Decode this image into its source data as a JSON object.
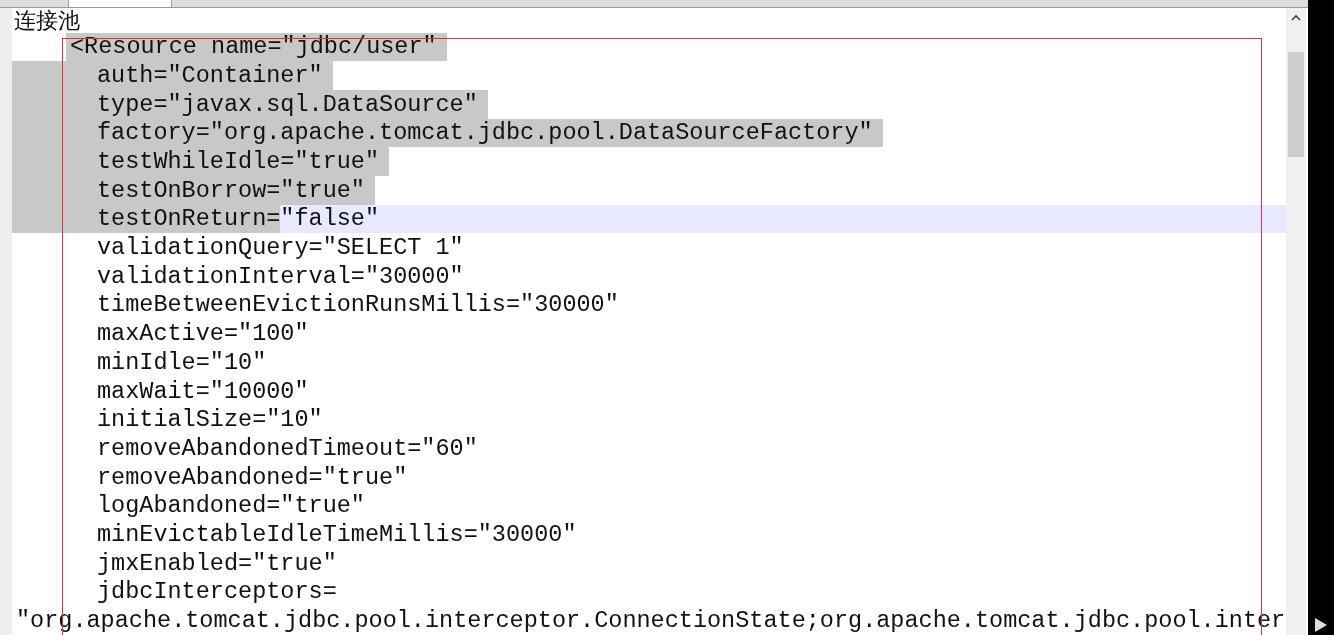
{
  "heading": "连接池",
  "lines": [
    {
      "kind": "tag",
      "text": "<Resource name=\"jdbc/user\"",
      "selected": true,
      "current": false
    },
    {
      "kind": "attribute",
      "text": "auth=\"Container\"",
      "selected": true,
      "current": false
    },
    {
      "kind": "attribute",
      "text": "type=\"javax.sql.DataSource\"",
      "selected": true,
      "current": false
    },
    {
      "kind": "attribute",
      "text": "factory=\"org.apache.tomcat.jdbc.pool.DataSourceFactory\"",
      "selected": true,
      "current": false
    },
    {
      "kind": "attribute",
      "text": "testWhileIdle=\"true\"",
      "selected": true,
      "current": false
    },
    {
      "kind": "attribute",
      "text": "testOnBorrow=\"true\"",
      "selected": true,
      "current": false
    },
    {
      "kind": "attribute",
      "selected_text": "testOnReturn=",
      "text": "\"false\"",
      "selected": true,
      "current": true
    },
    {
      "kind": "attribute",
      "text": "validationQuery=\"SELECT 1\"",
      "selected": false,
      "current": false
    },
    {
      "kind": "attribute",
      "text": "validationInterval=\"30000\"",
      "selected": false,
      "current": false
    },
    {
      "kind": "attribute",
      "text": "timeBetweenEvictionRunsMillis=\"30000\"",
      "selected": false,
      "current": false
    },
    {
      "kind": "attribute",
      "text": "maxActive=\"100\"",
      "selected": false,
      "current": false
    },
    {
      "kind": "attribute",
      "text": "minIdle=\"10\"",
      "selected": false,
      "current": false
    },
    {
      "kind": "attribute",
      "text": "maxWait=\"10000\"",
      "selected": false,
      "current": false
    },
    {
      "kind": "attribute",
      "text": "initialSize=\"10\"",
      "selected": false,
      "current": false
    },
    {
      "kind": "attribute",
      "text": "removeAbandonedTimeout=\"60\"",
      "selected": false,
      "current": false
    },
    {
      "kind": "attribute",
      "text": "removeAbandoned=\"true\"",
      "selected": false,
      "current": false
    },
    {
      "kind": "attribute",
      "text": "logAbandoned=\"true\"",
      "selected": false,
      "current": false
    },
    {
      "kind": "attribute",
      "text": "minEvictableIdleTimeMillis=\"30000\"",
      "selected": false,
      "current": false
    },
    {
      "kind": "attribute",
      "text": "jmxEnabled=\"true\"",
      "selected": false,
      "current": false
    },
    {
      "kind": "attribute",
      "text": "jdbcInterceptors=",
      "selected": false,
      "current": false
    },
    {
      "kind": "wrapped",
      "text": "\"org.apache.tomcat.jdbc.pool.interceptor.ConnectionState;org.apache.tomcat.jdbc.pool.inter",
      "selected": false,
      "current": false
    }
  ]
}
